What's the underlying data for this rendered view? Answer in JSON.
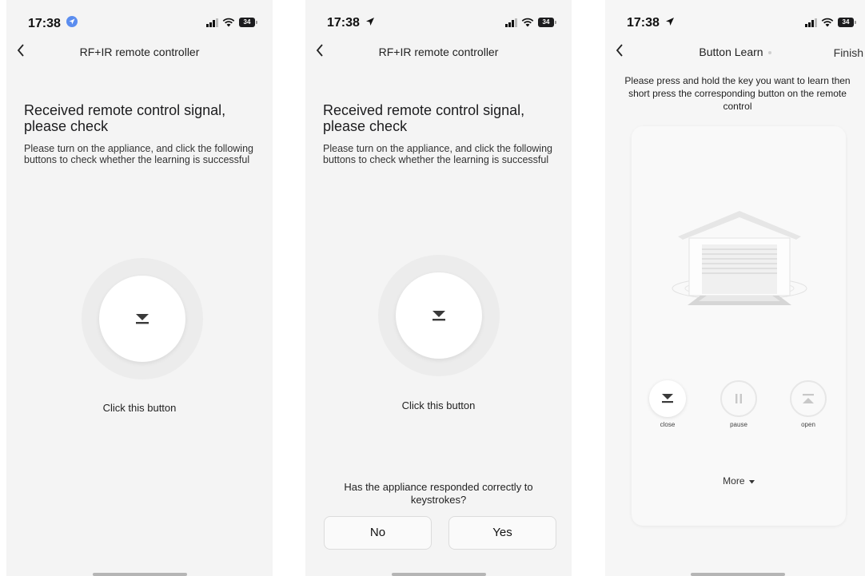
{
  "screens": [
    {
      "time": "17:38",
      "battery": "34",
      "nav_title": "RF+IR remote controller",
      "heading": "Received remote control signal, please check",
      "description": "Please turn on the appliance, and click the following buttons to check whether the learning is successful",
      "click_hint": "Click this button"
    },
    {
      "time": "17:38",
      "battery": "34",
      "nav_title": "RF+IR remote controller",
      "heading": "Received remote control signal, please check",
      "description": "Please turn on the appliance, and click the following buttons to check whether the learning is successful",
      "click_hint": "Click this button",
      "question": "Has the appliance responded correctly to keystrokes?",
      "no_label": "No",
      "yes_label": "Yes"
    },
    {
      "time": "17:38",
      "battery": "34",
      "nav_title": "Button Learn",
      "finish_label": "Finish",
      "instruction": "Please press and hold the key you want to learn then short press the corresponding button on the remote control",
      "controls": [
        {
          "label": "close",
          "icon": "close-arrow-icon",
          "active": true
        },
        {
          "label": "pause",
          "icon": "pause-icon",
          "active": false
        },
        {
          "label": "open",
          "icon": "open-arrow-icon",
          "active": false
        }
      ],
      "more_label": "More"
    }
  ],
  "icons": {
    "back": "chevron-left-icon",
    "location": "location-arrow-icon",
    "signal": "signal-icon",
    "wifi": "wifi-icon",
    "battery": "battery-icon",
    "garage": "garage-door-icon",
    "dropdown": "caret-down-icon"
  },
  "colors": {
    "screen_bg": "#f4f4f4",
    "halo": "#ececec",
    "button_bg": "#ffffff",
    "icon_dark": "#3a3a3a",
    "inactive": "#c8c8c8"
  }
}
